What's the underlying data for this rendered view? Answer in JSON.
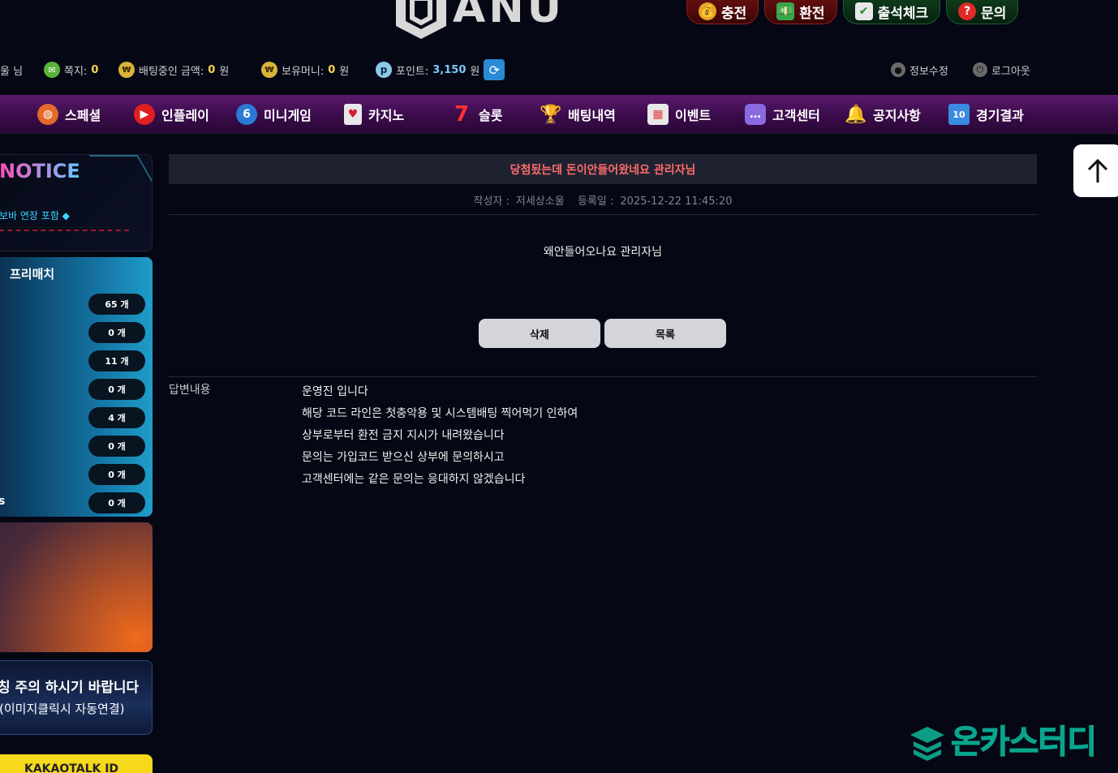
{
  "logo": {
    "text": "ANU"
  },
  "top_buttons": [
    {
      "label": "충전",
      "icon": "money-bag-icon"
    },
    {
      "label": "환전",
      "icon": "cash-icon"
    },
    {
      "label": "출석체크",
      "icon": "calendar-check-icon"
    },
    {
      "label": "문의",
      "icon": "question-icon"
    }
  ],
  "userbar": {
    "username_suffix": "울 님",
    "messages_label": "쪽지:",
    "messages_value": "0",
    "betting_label": "배팅중인 금액:",
    "betting_value": "0",
    "betting_unit": "원",
    "money_label": "보유머니:",
    "money_value": "0",
    "money_unit": "원",
    "points_label": "포인트:",
    "points_value": "3,150",
    "points_unit": "원",
    "coin_glyph": "₩",
    "points_glyph": "p",
    "profile_label": "정보수정",
    "logout_label": "로그아웃"
  },
  "nav": [
    {
      "label": "스페셜",
      "icon": "basketball-icon",
      "color": "#e46a2a"
    },
    {
      "label": "인플레이",
      "icon": "play-icon",
      "color": "#e02020"
    },
    {
      "label": "미니게임",
      "icon": "ball-icon",
      "color": "#2a7ad6"
    },
    {
      "label": "카지노",
      "icon": "card-icon",
      "color": "#d8d8d8"
    },
    {
      "label": "슬롯",
      "icon": "seven-icon",
      "color": "#e02020"
    },
    {
      "label": "배팅내역",
      "icon": "trophy-icon",
      "color": "#e0a020"
    },
    {
      "label": "이벤트",
      "icon": "calendar-icon",
      "color": "#e04040"
    },
    {
      "label": "고객센터",
      "icon": "chat-icon",
      "color": "#8a6ae0"
    },
    {
      "label": "공지사항",
      "icon": "bell-icon",
      "color": "#f0b020"
    },
    {
      "label": "경기결과",
      "icon": "scoreboard-icon",
      "color": "#3a8ae0"
    }
  ],
  "notice": {
    "title": "NOTICE",
    "line": "보바 연장 포함 ◆"
  },
  "prematch": {
    "title": "프리매치",
    "rows": [
      {
        "name": "",
        "count": "65 개"
      },
      {
        "name": "",
        "count": "0 개"
      },
      {
        "name": "",
        "count": "11 개"
      },
      {
        "name": "",
        "count": "0 개"
      },
      {
        "name": "",
        "count": "4 개"
      },
      {
        "name": "",
        "count": "0 개"
      },
      {
        "name": "",
        "count": "0 개"
      },
      {
        "name": "s",
        "count": "0 개"
      }
    ]
  },
  "banners": {
    "warn_line1": "칭 주의 하시기 바랍니다",
    "warn_line2": "(이미지클릭시 자동연결)",
    "kakao": "KAKAOTALK ID"
  },
  "post": {
    "title": "당첨됬는데 돈이안들어왔네요 관리자님",
    "author_label": "작성자 :",
    "author": "저세상소울",
    "date_label": "등록일 :",
    "date": "2025-12-22 11:45:20",
    "body": "왜안들어오나요 관리자님",
    "delete_label": "삭제",
    "list_label": "목록",
    "answer_label": "답변내용",
    "answer_lines": [
      "운영진 입니다",
      "해당 코드 라인은 첫충악용 및 시스템배팅 찍어먹기 인하여",
      "상부로부터 환전 금지 지시가 내려왔습니다",
      "문의는 가입코드 받으신 상부에 문의하시고",
      "고객센터에는 같은 문의는 응대하지 않겠습니다"
    ]
  },
  "watermark": {
    "text": "온카스터디"
  }
}
